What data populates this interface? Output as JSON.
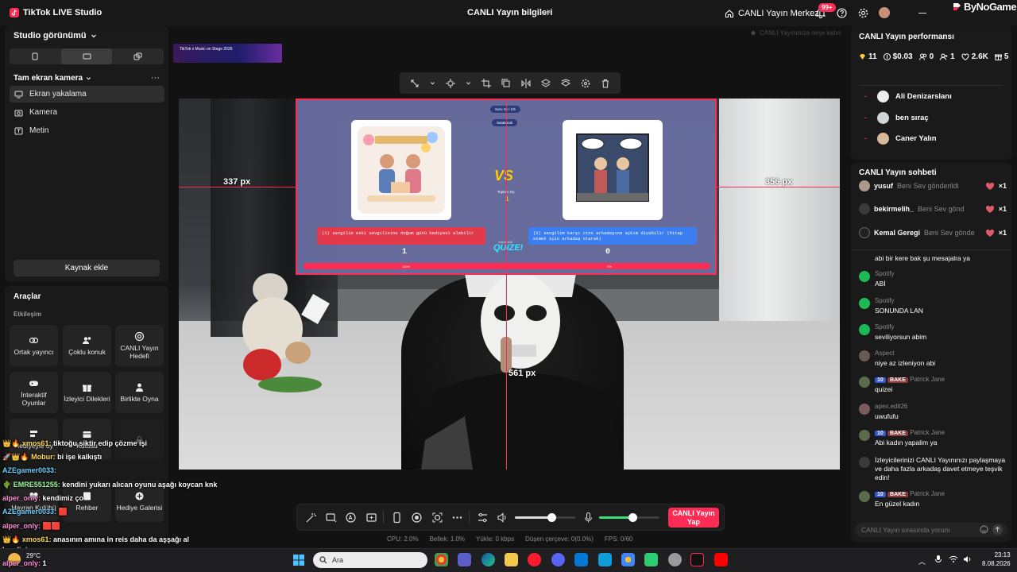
{
  "titlebar": {
    "app_title": "TikTok LIVE Studio",
    "stream_info": "CANLI Yayın bilgileri",
    "live_center": "CANLI Yayın Merkezi",
    "notif_count": "99+",
    "watermark": "ByNoGame"
  },
  "left": {
    "studio_view": "Studio görünümü",
    "scene": "Tam ekran kamera",
    "sources": [
      "Ekran yakalama",
      "Kamera",
      "Metin"
    ],
    "add_source": "Kaynak ekle",
    "tools_title": "Araçlar",
    "interaction": "Etkileşim",
    "tools": [
      "Ortak yayıncı",
      "Çoklu konuk",
      "CANLI Yayın Hedefi",
      "İnteraktif Oyunlar",
      "İzleyici Dilekleri",
      "Birlikte Oyna",
      "Hediyeyle oy",
      "Kutusu",
      "Hayran Kulübü",
      "Rehber",
      "Hediye Galerisi"
    ]
  },
  "preview": {
    "promo_text": "TikTok x Music on Stage 2026",
    "hint": "CANLI Yayınınıza neşe katın",
    "px_left": "337 px",
    "px_right": "356 px",
    "px_bottom": "561 px",
    "quiz": {
      "round": "Soru 16 / 1/6",
      "question_pill": "Satakmak",
      "vs": "VS",
      "total_label": "Toplam Oy",
      "total": "1",
      "left_answer": "(1) sevgilim eski sevgilisine doğum günü hediyesi alabilir",
      "right_answer": "(2) sevgilim karşı cins arkadaşına açkım diyebilir (hitap etmek için arkadaş olarak)",
      "left_count": "1",
      "right_count": "0",
      "left_pct": "100%",
      "right_pct": "0%",
      "logo": "QUIZE!",
      "logo_small": "made with"
    }
  },
  "controls": {
    "go_live": "CANLI Yayın Yap",
    "cpu": "CPU:  2.0%",
    "memory": "Bellek:  1.0%",
    "upload": "Yükle:  0 kbps",
    "dropped": "Düşen çerçeve:  0(0.0%)",
    "fps": "FPS:  0/60",
    "volume_level": 0.6,
    "mic_level": 0.55
  },
  "performance": {
    "title": "CANLI Yayın performansı",
    "diamonds": "11",
    "earnings": "$0.03",
    "new_followers": "0",
    "viewers": "1",
    "likes": "2.6K",
    "gifts": "5",
    "top_viewers": [
      "Ali Denizarslanı",
      "ben sıraç",
      "Caner Yalın"
    ]
  },
  "chat": {
    "title": "CANLI Yayın sohbeti",
    "gifts": [
      {
        "user": "yusuf",
        "text": "Beni Sev gönderildi",
        "count": "×1"
      },
      {
        "user": "bekirmelih_",
        "text": "Beni Sev gönd",
        "count": "×1"
      },
      {
        "user": "Kemal Geregi",
        "text": "Beni Sev gönde",
        "count": "×1"
      }
    ],
    "messages": [
      {
        "name": "",
        "text": "abi bir kere bak şu mesajalra ya",
        "color": "#1a1a1a"
      },
      {
        "name": "Spotify",
        "text": "ABİ",
        "color": "#1db954"
      },
      {
        "name": "Spotify",
        "text": "SONUNDA LAN",
        "color": "#1db954"
      },
      {
        "name": "Spotify",
        "text": "seviliyorsun abim",
        "color": "#1db954"
      },
      {
        "name": "Aspect",
        "text": "niye az izleniyon abi",
        "color": "#6a5a50"
      },
      {
        "name": "Patrick Jane",
        "text": "quizei",
        "color": "#5a6a4a",
        "level": "10",
        "fan": "BAKE"
      },
      {
        "name": "apex.edit26",
        "text": "uwufufu",
        "color": "#7a5a5a"
      },
      {
        "name": "Patrick Jane",
        "text": "Abi kadın yapalim ya",
        "color": "#5a6a4a",
        "level": "10",
        "fan": "BAKE"
      },
      {
        "name": "",
        "text": "İzleyicilerinizi CANLI Yayınınızı paylaşmaya ve daha fazla arkadaş davet etmeye teşvik edin!",
        "color": "#3a3a3a"
      },
      {
        "name": "Patrick Jane",
        "text": "En güzel kadın",
        "color": "#5a6a4a",
        "level": "10",
        "fan": "BAKE"
      }
    ],
    "input_placeholder": "CANLI Yayın sırasında yorum"
  },
  "overlay_chat": [
    {
      "user": "xmos61:",
      "text": "tiktoğu siktir edip çözme işi"
    },
    {
      "user": "Mobur:",
      "text": "bi işe kalkıştı"
    },
    {
      "user": "AZEgamer0033:",
      "text": ""
    },
    {
      "user": "EMRE551255:",
      "text": "kendini yukarı alıcan oyunu aşağı koycan knk"
    },
    {
      "user": "alper_only:",
      "text": "kendimiz ço"
    },
    {
      "user": "AZEgamer0033:",
      "text": ""
    },
    {
      "user": "alper_only:",
      "text": ""
    },
    {
      "user": "xmos61:",
      "text": "anasının amına in reis daha da aşşağı al"
    },
    {
      "user": "",
      "text": "kendini"
    },
    {
      "user": "alper_only:",
      "text": "1"
    }
  ],
  "taskbar": {
    "search": "Ara",
    "weather": "29°C",
    "time": "23:13",
    "date": "8.08.2026"
  },
  "colors": {
    "accent": "#fe2c55",
    "panel": "#1a1a1a",
    "background": "#121212"
  }
}
